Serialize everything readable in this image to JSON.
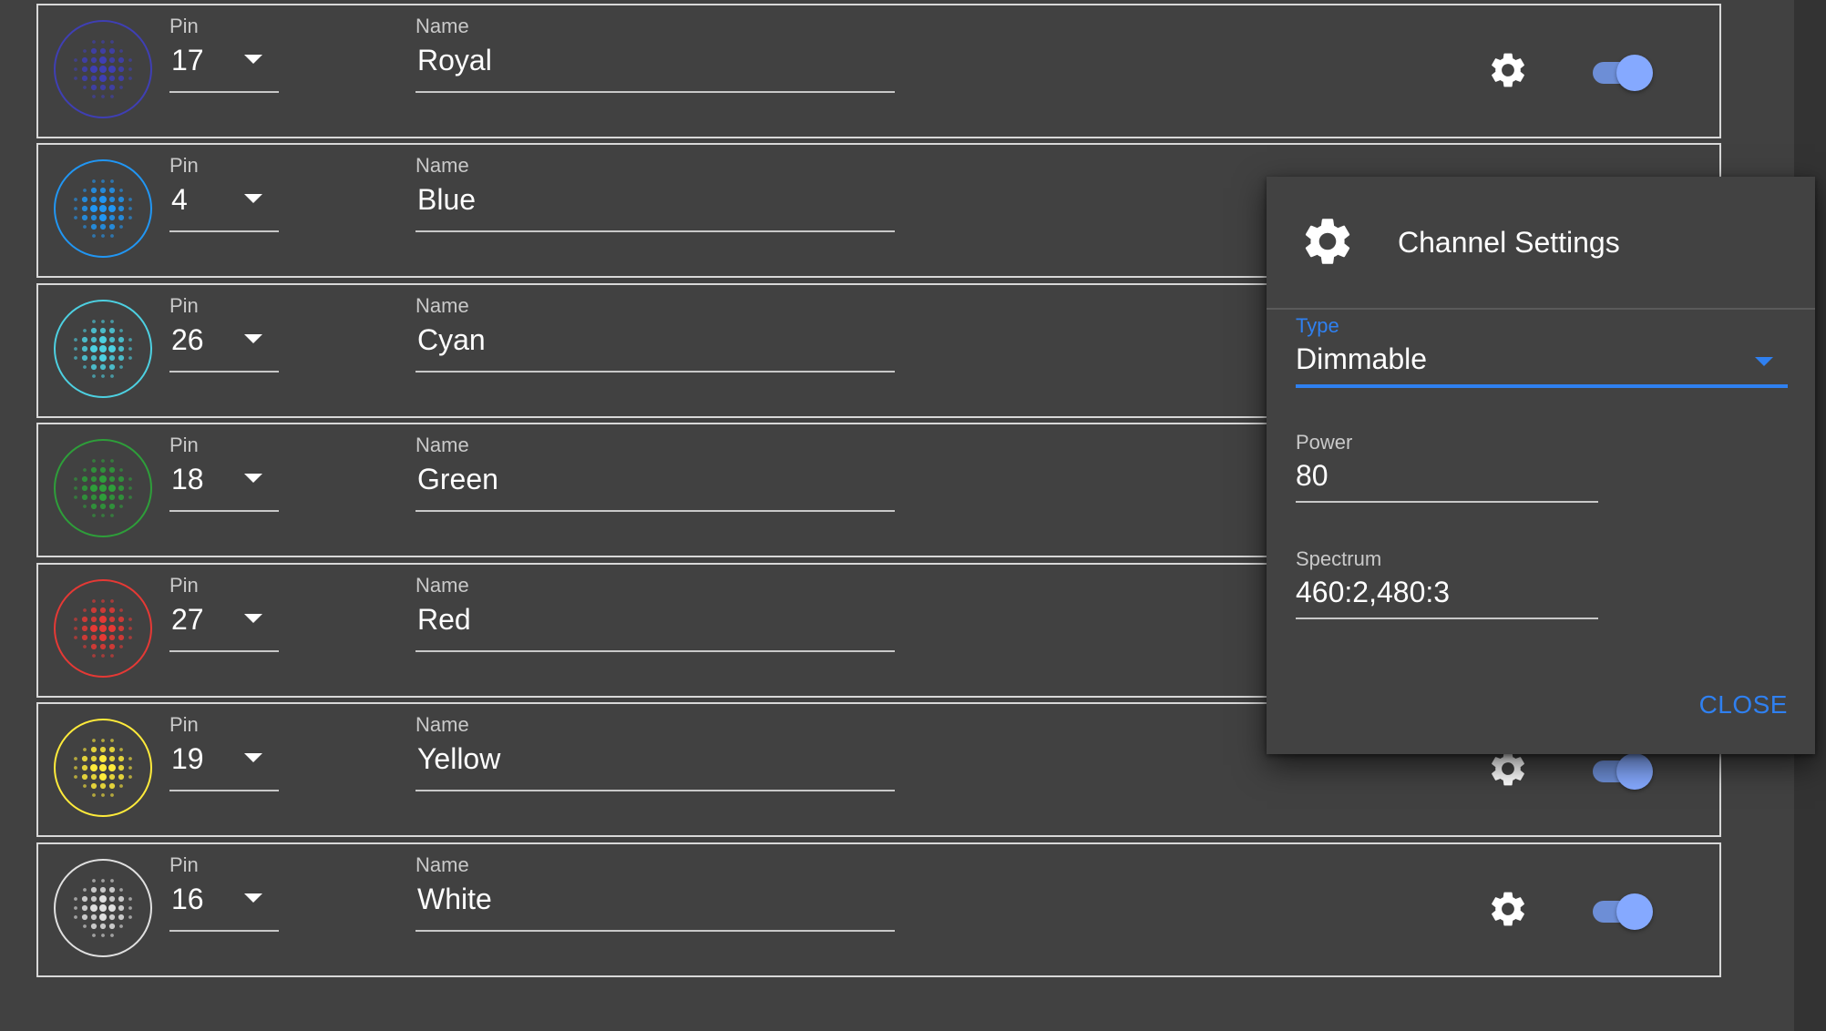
{
  "colors": {
    "background": "#414141",
    "accent": "#2f80f0",
    "toggle_on": "#85a9ff"
  },
  "channels": [
    {
      "pin_label": "Pin",
      "pin": "17",
      "name_label": "Name",
      "name": "Royal",
      "color": "#3f3fb4",
      "enabled": true
    },
    {
      "pin_label": "Pin",
      "pin": "4",
      "name_label": "Name",
      "name": "Blue",
      "color": "#2196f3",
      "enabled": true
    },
    {
      "pin_label": "Pin",
      "pin": "26",
      "name_label": "Name",
      "name": "Cyan",
      "color": "#4dd0e1",
      "enabled": true
    },
    {
      "pin_label": "Pin",
      "pin": "18",
      "name_label": "Name",
      "name": "Green",
      "color": "#2e9e3a",
      "enabled": true
    },
    {
      "pin_label": "Pin",
      "pin": "27",
      "name_label": "Name",
      "name": "Red",
      "color": "#e53935",
      "enabled": true
    },
    {
      "pin_label": "Pin",
      "pin": "19",
      "name_label": "Name",
      "name": "Yellow",
      "color": "#ffeb3b",
      "enabled": true
    },
    {
      "pin_label": "Pin",
      "pin": "16",
      "name_label": "Name",
      "name": "White",
      "color": "#e0e0e0",
      "enabled": true
    }
  ],
  "icons": {
    "settings": "gear-icon",
    "led": "led-dots-icon",
    "dropdown": "caret-down-icon"
  },
  "dialog": {
    "title": "Channel Settings",
    "type_label": "Type",
    "type_value": "Dimmable",
    "power_label": "Power",
    "power_value": "80",
    "spectrum_label": "Spectrum",
    "spectrum_value": "460:2,480:3",
    "close_label": "CLOSE"
  }
}
